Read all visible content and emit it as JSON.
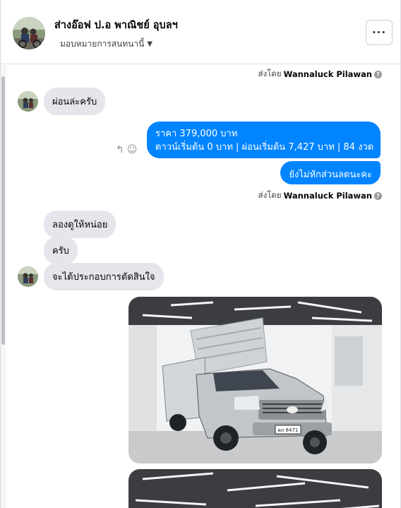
{
  "header": {
    "name": "ส่างอ๊อฟ ป.อ พาณิชย์ อุบลฯ",
    "assign_label": "มอบหมายการสนทนานี้",
    "more_label": "···"
  },
  "icons": {
    "more": "more-horizontal-icon",
    "caret": "chevron-down-icon",
    "info": "info-icon",
    "reply": "reply-icon",
    "react": "smiley-icon"
  },
  "colors": {
    "sent_bubble": "#0084ff",
    "received_bubble": "#e4e6eb"
  },
  "messages": {
    "sent_by_prefix": "ส่งโดย",
    "sender": "Wannaluck Pilawan",
    "in_1": "ผ่อนล่ะครับ",
    "out_1_line1": "ราคา 379,000 บาท",
    "out_1_line2": "ดาวน์เริ่มต้น 0 บาท | ผ่อนเริ่มต้น 7,427 บาท | 84 งวด",
    "out_2": "ยังไม่หักส่วนลดนะคะ",
    "in_2": "ลองดูให้หน่อย",
    "in_3": "ครับ",
    "in_4": "จะได้ประกอบการตัดสินใจ",
    "plate": "ผภ 8471"
  }
}
